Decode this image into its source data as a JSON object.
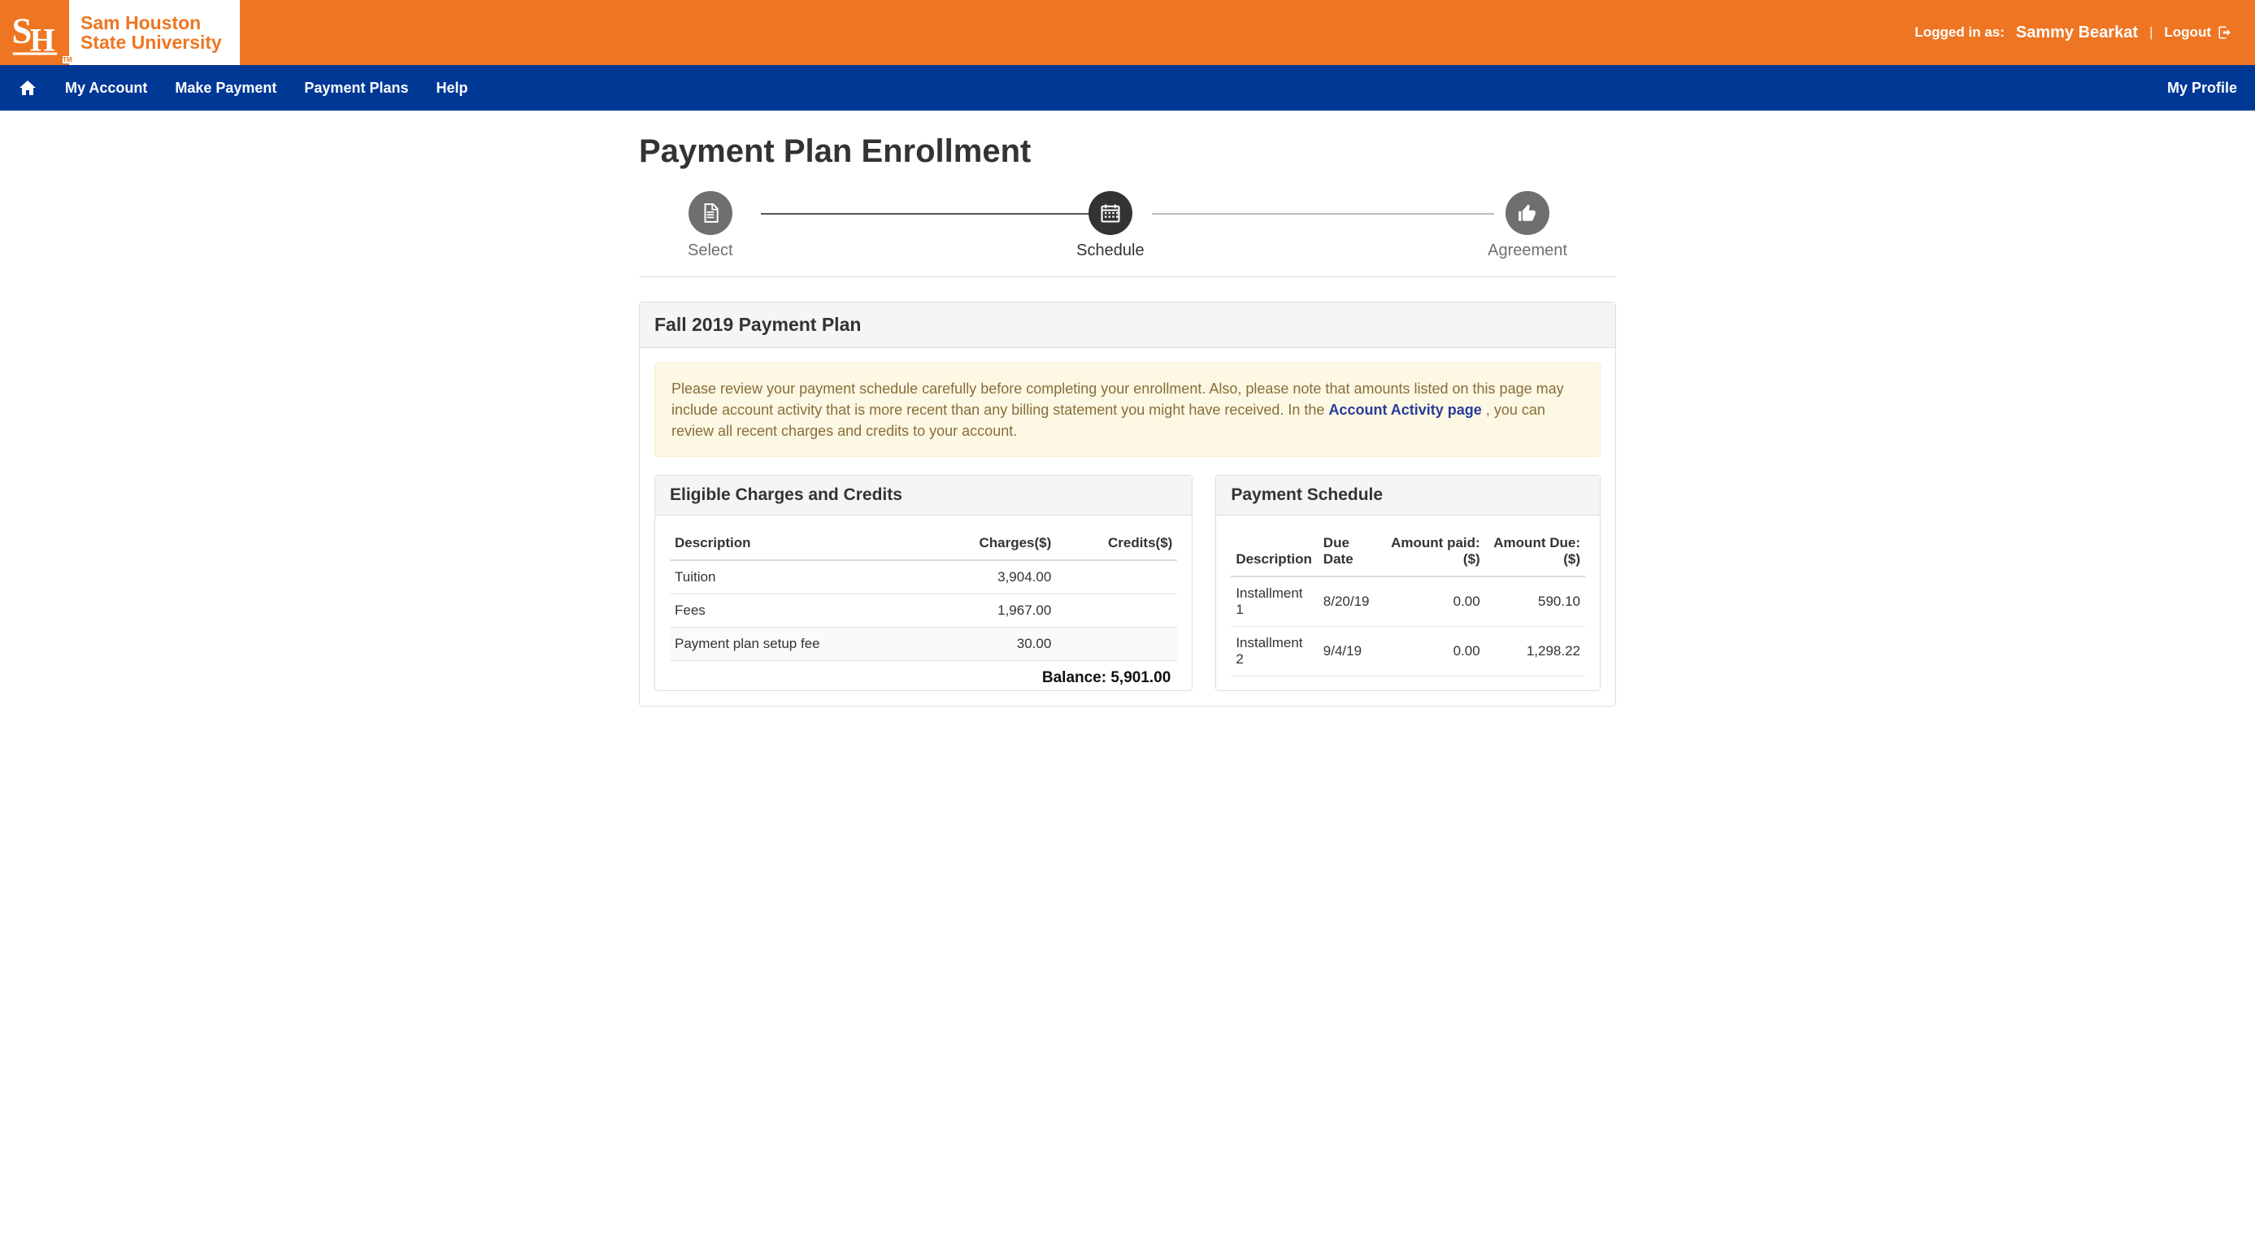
{
  "header": {
    "brand_line1": "Sam Houston",
    "brand_line2": "State University",
    "logged_in_label": "Logged in as:",
    "user_name": "Sammy Bearkat",
    "logout_label": "Logout"
  },
  "nav": {
    "items": [
      "My Account",
      "Make Payment",
      "Payment Plans",
      "Help"
    ],
    "profile": "My Profile"
  },
  "page": {
    "title": "Payment Plan Enrollment"
  },
  "stepper": {
    "steps": [
      {
        "label": "Select",
        "active": false
      },
      {
        "label": "Schedule",
        "active": true
      },
      {
        "label": "Agreement",
        "active": false
      }
    ]
  },
  "plan": {
    "title": "Fall 2019 Payment Plan",
    "alert_pre": "Please review your payment schedule carefully before completing your enrollment. Also, please note that amounts listed on this page may include account activity that is more recent than any billing statement you might have received. In the ",
    "alert_link": "Account Activity page",
    "alert_post": " , you can review all recent charges and credits to your account."
  },
  "eligible": {
    "title": "Eligible Charges and Credits",
    "headers": {
      "desc": "Description",
      "charges": "Charges($)",
      "credits": "Credits($)"
    },
    "rows": [
      {
        "desc": "Tuition",
        "charges": "3,904.00",
        "credits": ""
      },
      {
        "desc": "Fees",
        "charges": "1,967.00",
        "credits": ""
      },
      {
        "desc": "Payment plan setup fee",
        "charges": "30.00",
        "credits": ""
      }
    ],
    "balance_label": "Balance:",
    "balance_value": "5,901.00"
  },
  "schedule": {
    "title": "Payment Schedule",
    "headers": {
      "desc": "Description",
      "due": "Due Date",
      "paid": "Amount paid: ($)",
      "amount": "Amount Due: ($)"
    },
    "rows": [
      {
        "desc": "Installment 1",
        "due": "8/20/19",
        "paid": "0.00",
        "amount": "590.10"
      },
      {
        "desc": "Installment 2",
        "due": "9/4/19",
        "paid": "0.00",
        "amount": "1,298.22"
      }
    ]
  }
}
